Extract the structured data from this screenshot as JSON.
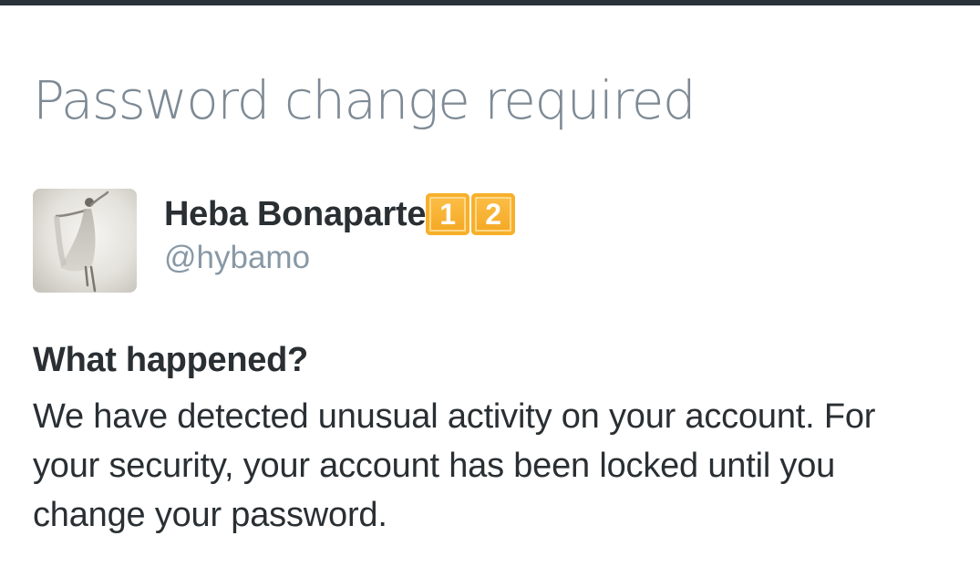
{
  "colors": {
    "top_bar": "#2a3139",
    "title": "#7d8a95",
    "name": "#292f33",
    "handle": "#8899a6",
    "body_text": "#292f33",
    "keycap_orange": "#f4a621"
  },
  "header": {
    "title": "Password change required"
  },
  "profile": {
    "avatar_icon": "dancer-photo",
    "display_name": "Heba Bonaparte",
    "keycap_badges": [
      "1",
      "2"
    ],
    "handle": "@hybamo"
  },
  "notice": {
    "heading": "What happened?",
    "body": "We have detected unusual activity on your account. For your security, your account has been locked until you change your password."
  }
}
